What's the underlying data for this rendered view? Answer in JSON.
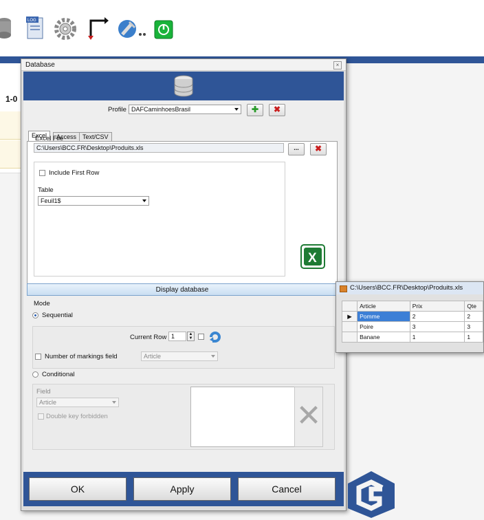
{
  "window": {
    "title": "Database"
  },
  "background": {
    "side_text": "1-0"
  },
  "profile": {
    "label": "Profile",
    "value": "DAFCaminhoesBrasil"
  },
  "tabs": [
    {
      "label": "Excel"
    },
    {
      "label": "Access"
    },
    {
      "label": "Text/CSV"
    }
  ],
  "excel": {
    "file_label": "Excel File",
    "file_value": "C:\\Users\\BCC.FR\\Desktop\\Produits.xls",
    "browse_label": "...",
    "include_first_row": "Include First Row",
    "table_label": "Table",
    "table_value": "Feuil1$"
  },
  "display_button": "Display database",
  "mode": {
    "label": "Mode",
    "sequential": "Sequential",
    "current_row_label": "Current Row",
    "current_row_value": "1",
    "markings_label": "Number of markings field",
    "markings_value": "Article",
    "conditional": "Conditional",
    "field_label": "Field",
    "field_value": "Article",
    "double_key": "Double key forbidden"
  },
  "footer": {
    "ok": "OK",
    "apply": "Apply",
    "cancel": "Cancel"
  },
  "popup": {
    "title": "C:\\Users\\BCC.FR\\Desktop\\Produits.xls",
    "columns": [
      "Article",
      "Prix",
      "Qte"
    ],
    "rows": [
      {
        "marker": "▶",
        "cells": [
          "Pomme",
          "2",
          "2"
        ]
      },
      {
        "marker": "",
        "cells": [
          "Poire",
          "3",
          "3"
        ]
      },
      {
        "marker": "",
        "cells": [
          "Banane",
          "1",
          "1"
        ]
      }
    ]
  },
  "colors": {
    "accent": "#2f5597",
    "excel_green": "#1e7b34",
    "selection": "#3c7fd6"
  }
}
